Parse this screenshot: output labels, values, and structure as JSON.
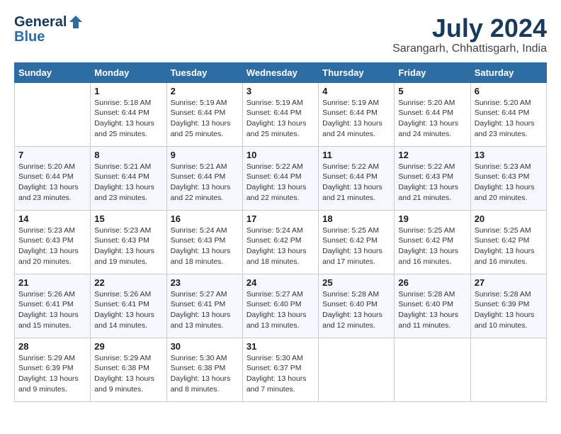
{
  "header": {
    "logo_general": "General",
    "logo_blue": "Blue",
    "month_title": "July 2024",
    "location": "Sarangarh, Chhattisgarh, India"
  },
  "days_of_week": [
    "Sunday",
    "Monday",
    "Tuesday",
    "Wednesday",
    "Thursday",
    "Friday",
    "Saturday"
  ],
  "weeks": [
    [
      {
        "day": "",
        "info": ""
      },
      {
        "day": "1",
        "info": "Sunrise: 5:18 AM\nSunset: 6:44 PM\nDaylight: 13 hours\nand 25 minutes."
      },
      {
        "day": "2",
        "info": "Sunrise: 5:19 AM\nSunset: 6:44 PM\nDaylight: 13 hours\nand 25 minutes."
      },
      {
        "day": "3",
        "info": "Sunrise: 5:19 AM\nSunset: 6:44 PM\nDaylight: 13 hours\nand 25 minutes."
      },
      {
        "day": "4",
        "info": "Sunrise: 5:19 AM\nSunset: 6:44 PM\nDaylight: 13 hours\nand 24 minutes."
      },
      {
        "day": "5",
        "info": "Sunrise: 5:20 AM\nSunset: 6:44 PM\nDaylight: 13 hours\nand 24 minutes."
      },
      {
        "day": "6",
        "info": "Sunrise: 5:20 AM\nSunset: 6:44 PM\nDaylight: 13 hours\nand 23 minutes."
      }
    ],
    [
      {
        "day": "7",
        "info": "Sunrise: 5:20 AM\nSunset: 6:44 PM\nDaylight: 13 hours\nand 23 minutes."
      },
      {
        "day": "8",
        "info": "Sunrise: 5:21 AM\nSunset: 6:44 PM\nDaylight: 13 hours\nand 23 minutes."
      },
      {
        "day": "9",
        "info": "Sunrise: 5:21 AM\nSunset: 6:44 PM\nDaylight: 13 hours\nand 22 minutes."
      },
      {
        "day": "10",
        "info": "Sunrise: 5:22 AM\nSunset: 6:44 PM\nDaylight: 13 hours\nand 22 minutes."
      },
      {
        "day": "11",
        "info": "Sunrise: 5:22 AM\nSunset: 6:44 PM\nDaylight: 13 hours\nand 21 minutes."
      },
      {
        "day": "12",
        "info": "Sunrise: 5:22 AM\nSunset: 6:43 PM\nDaylight: 13 hours\nand 21 minutes."
      },
      {
        "day": "13",
        "info": "Sunrise: 5:23 AM\nSunset: 6:43 PM\nDaylight: 13 hours\nand 20 minutes."
      }
    ],
    [
      {
        "day": "14",
        "info": "Sunrise: 5:23 AM\nSunset: 6:43 PM\nDaylight: 13 hours\nand 20 minutes."
      },
      {
        "day": "15",
        "info": "Sunrise: 5:23 AM\nSunset: 6:43 PM\nDaylight: 13 hours\nand 19 minutes."
      },
      {
        "day": "16",
        "info": "Sunrise: 5:24 AM\nSunset: 6:43 PM\nDaylight: 13 hours\nand 18 minutes."
      },
      {
        "day": "17",
        "info": "Sunrise: 5:24 AM\nSunset: 6:42 PM\nDaylight: 13 hours\nand 18 minutes."
      },
      {
        "day": "18",
        "info": "Sunrise: 5:25 AM\nSunset: 6:42 PM\nDaylight: 13 hours\nand 17 minutes."
      },
      {
        "day": "19",
        "info": "Sunrise: 5:25 AM\nSunset: 6:42 PM\nDaylight: 13 hours\nand 16 minutes."
      },
      {
        "day": "20",
        "info": "Sunrise: 5:25 AM\nSunset: 6:42 PM\nDaylight: 13 hours\nand 16 minutes."
      }
    ],
    [
      {
        "day": "21",
        "info": "Sunrise: 5:26 AM\nSunset: 6:41 PM\nDaylight: 13 hours\nand 15 minutes."
      },
      {
        "day": "22",
        "info": "Sunrise: 5:26 AM\nSunset: 6:41 PM\nDaylight: 13 hours\nand 14 minutes."
      },
      {
        "day": "23",
        "info": "Sunrise: 5:27 AM\nSunset: 6:41 PM\nDaylight: 13 hours\nand 13 minutes."
      },
      {
        "day": "24",
        "info": "Sunrise: 5:27 AM\nSunset: 6:40 PM\nDaylight: 13 hours\nand 13 minutes."
      },
      {
        "day": "25",
        "info": "Sunrise: 5:28 AM\nSunset: 6:40 PM\nDaylight: 13 hours\nand 12 minutes."
      },
      {
        "day": "26",
        "info": "Sunrise: 5:28 AM\nSunset: 6:40 PM\nDaylight: 13 hours\nand 11 minutes."
      },
      {
        "day": "27",
        "info": "Sunrise: 5:28 AM\nSunset: 6:39 PM\nDaylight: 13 hours\nand 10 minutes."
      }
    ],
    [
      {
        "day": "28",
        "info": "Sunrise: 5:29 AM\nSunset: 6:39 PM\nDaylight: 13 hours\nand 9 minutes."
      },
      {
        "day": "29",
        "info": "Sunrise: 5:29 AM\nSunset: 6:38 PM\nDaylight: 13 hours\nand 9 minutes."
      },
      {
        "day": "30",
        "info": "Sunrise: 5:30 AM\nSunset: 6:38 PM\nDaylight: 13 hours\nand 8 minutes."
      },
      {
        "day": "31",
        "info": "Sunrise: 5:30 AM\nSunset: 6:37 PM\nDaylight: 13 hours\nand 7 minutes."
      },
      {
        "day": "",
        "info": ""
      },
      {
        "day": "",
        "info": ""
      },
      {
        "day": "",
        "info": ""
      }
    ]
  ]
}
